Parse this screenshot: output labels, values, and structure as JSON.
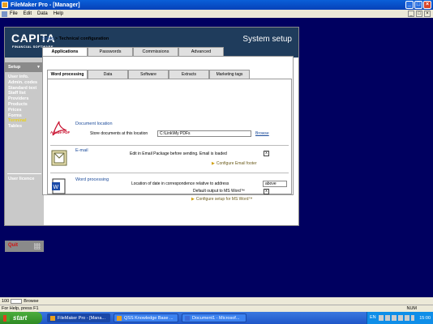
{
  "titlebar": {
    "title": "FileMaker Pro - [Manager]"
  },
  "menu": {
    "items": [
      "File",
      "Edit",
      "Data",
      "Help"
    ]
  },
  "header": {
    "brand": "CAPITA",
    "brand_sub": "FINANCIAL SOFTWARE",
    "title": "System setup"
  },
  "nav": {
    "section": "Setup",
    "items": [
      "User info.",
      "Admin. codes",
      "Standard text",
      "Staff list",
      "Providers",
      "Products",
      "Prices",
      "Forms",
      "Terminal",
      "Tables"
    ],
    "active_item": "Terminal",
    "user_licence": "User licence",
    "quit": "Quit"
  },
  "breadcrumb": {
    "root": "Setup",
    "separator": " > ",
    "current": "Technical configuration"
  },
  "tabs_main": [
    "Applications",
    "Passwords",
    "Commissions",
    "Advanced"
  ],
  "tabs_sub": [
    "Word processing",
    "Data",
    "Software",
    "Extracts",
    "Marketing tags"
  ],
  "doc_location": {
    "title": "Document location",
    "icon_text": "Adobe PDF",
    "label": "Store documents at this location",
    "value": "C:\\Link\\My PDFs",
    "browse": "Browse"
  },
  "email": {
    "title": "E-mail",
    "label": "Edit in Email Package before sending.  Email is loaded",
    "checkbox": "x",
    "action": "Configure Email footer"
  },
  "word": {
    "title": "Word processing",
    "label1": "Location of date in correspondence relative to address",
    "value1": "above",
    "label2": "Default output to MS Word™",
    "checkbox": "x",
    "action": "Configure setup for MS Word™"
  },
  "zoombar": {
    "zoom": "100",
    "mode": "Browse"
  },
  "status": {
    "text": "For Help, press F1",
    "num": "NUM"
  },
  "taskbar": {
    "start": "start",
    "items": [
      "FileMaker Pro - [Mana...",
      "QSS Knowledge Base ...",
      "Document1 - Microsof..."
    ],
    "lang": "EN",
    "clock": "15:00"
  }
}
